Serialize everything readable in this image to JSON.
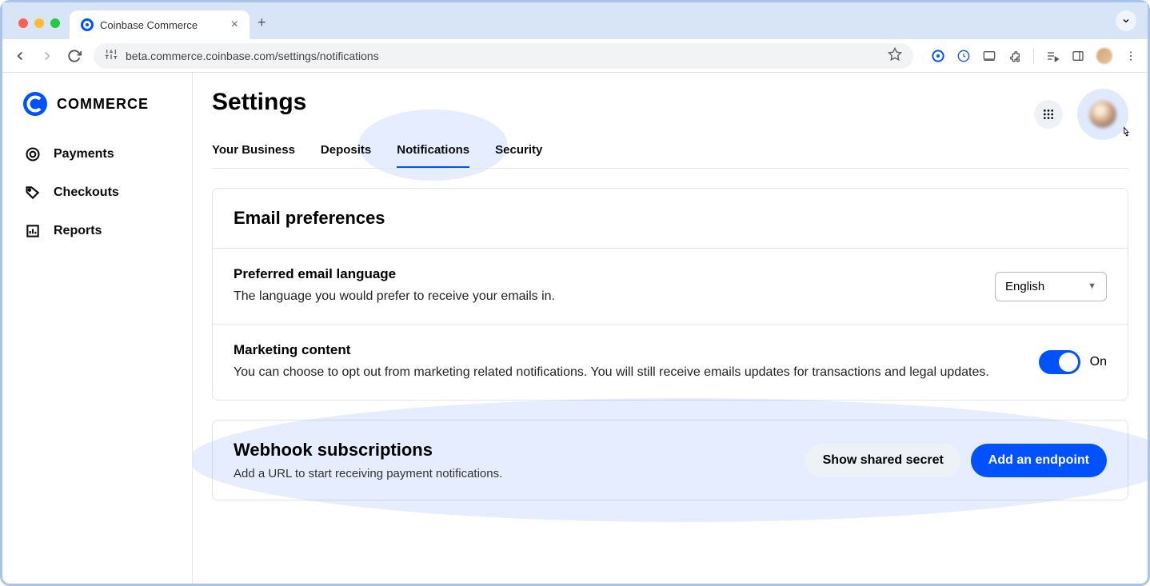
{
  "browser": {
    "tab_title": "Coinbase Commerce",
    "url": "beta.commerce.coinbase.com/settings/notifications"
  },
  "logo": {
    "text": "COMMERCE"
  },
  "sidebar": {
    "items": [
      {
        "label": "Payments"
      },
      {
        "label": "Checkouts"
      },
      {
        "label": "Reports"
      }
    ]
  },
  "page": {
    "title": "Settings"
  },
  "tabs": [
    {
      "label": "Your Business"
    },
    {
      "label": "Deposits"
    },
    {
      "label": "Notifications"
    },
    {
      "label": "Security"
    }
  ],
  "email_preferences": {
    "title": "Email preferences",
    "language": {
      "title": "Preferred email language",
      "desc": "The language you would prefer to receive your emails in.",
      "selected": "English"
    },
    "marketing": {
      "title": "Marketing content",
      "desc": "You can choose to opt out from marketing related notifications. You will still receive emails updates for transactions and legal updates.",
      "state": "On"
    }
  },
  "webhooks": {
    "title": "Webhook subscriptions",
    "subtitle": "Add a URL to start receiving payment notifications.",
    "show_secret": "Show shared secret",
    "add_endpoint": "Add an endpoint"
  }
}
